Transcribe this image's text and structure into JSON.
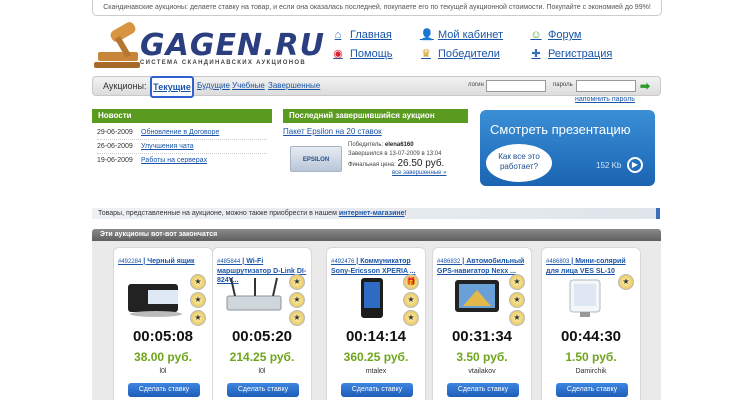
{
  "notice": "Скандинавские аукционы: делаете ставку на товар, и если она оказалась последней, покупаете его по текущей аукционной стоимости. Покупайте с экономией до 99%!",
  "logo": {
    "name": "GAGEN.RU",
    "subtitle": "СИСТЕМА СКАНДИНАВСКИХ АУКЦИОНОВ"
  },
  "nav": [
    {
      "label": "Главная",
      "icon": "home-icon"
    },
    {
      "label": "Мой кабинет",
      "icon": "user-icon"
    },
    {
      "label": "Форум",
      "icon": "forum-icon"
    },
    {
      "label": "Помощь",
      "icon": "help-icon"
    },
    {
      "label": "Победители",
      "icon": "trophy-icon"
    },
    {
      "label": "Регистрация",
      "icon": "register-icon"
    }
  ],
  "tabs": {
    "label": "Аукционы:",
    "items": [
      "Текущие",
      "Будущие",
      "Учебные",
      "Завершенные"
    ]
  },
  "login": {
    "login_label": "логин",
    "password_label": "пароль",
    "forgot": "напомнить пароль"
  },
  "news": {
    "title": "Новости",
    "items": [
      {
        "date": "29-06-2009",
        "text": "Обновление в Договоре"
      },
      {
        "date": "26-06-2009",
        "text": "Улучшения чата"
      },
      {
        "date": "19-06-2009",
        "text": "Работы на серверах"
      }
    ]
  },
  "last_auction": {
    "title": "Последний завершившийся аукцион",
    "item": "Пакет Epsilon на 20 ставок",
    "img_label": "EPSILON",
    "winner_label": "Победитель:",
    "winner": "elena6160",
    "ended": "Завершился в 13-07-2009 в 13:04",
    "price_label": "Финальная цена:",
    "price": "26.50 руб.",
    "all_link": "все завершенные »"
  },
  "presentation": {
    "title": "Смотреть презентацию",
    "bubble": "Как все это работает?",
    "size": "152 Kb"
  },
  "shop": {
    "text": "Товары, представленные на аукционе, можно также приобрести в нашем ",
    "link": "интернет-магазине",
    "end": "!"
  },
  "ending": {
    "title": "Эти аукционы вот-вот закончатся",
    "bid_label": "Сделать ставку",
    "cards": [
      {
        "id": "#492284",
        "title": "Черный ящик",
        "timer": "00:05:08",
        "price": "38.00 руб.",
        "user": "l0l"
      },
      {
        "id": "#485844",
        "title": "Wi-Fi маршрутизатор D-Link DI-824V...",
        "timer": "00:05:20",
        "price": "214.25 руб.",
        "user": "l0l"
      },
      {
        "id": "#492476",
        "title": "Коммуникатор Sony-Ericsson XPERIA ...",
        "timer": "00:14:14",
        "price": "360.25 руб.",
        "user": "mtalex"
      },
      {
        "id": "#486832",
        "title": "Автомобильный GPS-навигатор Nexx ...",
        "timer": "00:31:34",
        "price": "3.50 руб.",
        "user": "vtailakov"
      },
      {
        "id": "#486803",
        "title": "Мини-солярий для лица VES SL-10",
        "timer": "00:44:30",
        "price": "1.50 руб.",
        "user": "Damirchik"
      }
    ]
  }
}
